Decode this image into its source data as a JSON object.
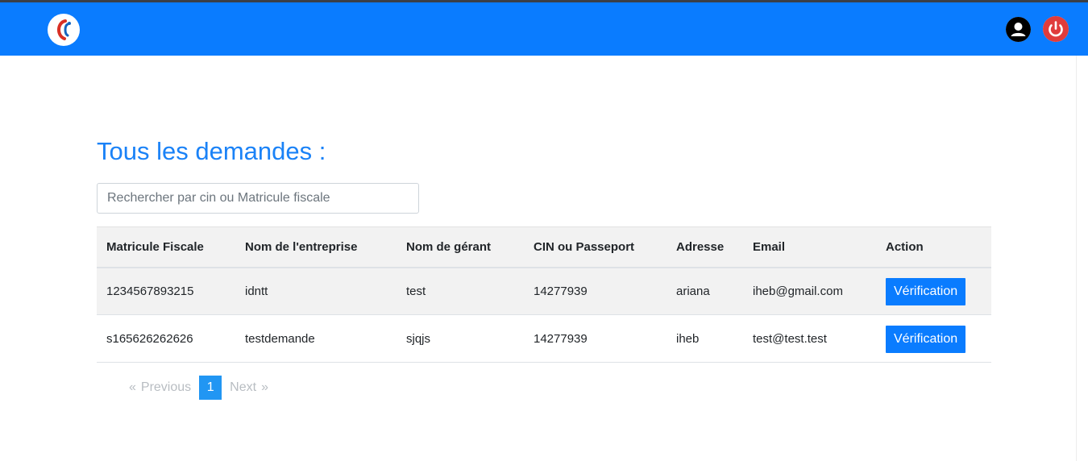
{
  "page": {
    "title": "Tous les demandes :"
  },
  "search": {
    "placeholder": "Rechercher par cin ou Matricule fiscale",
    "value": ""
  },
  "table": {
    "headers": [
      "Matricule Fiscale",
      "Nom de l'entreprise",
      "Nom de gérant",
      "CIN ou Passeport",
      "Adresse",
      "Email",
      "Action"
    ],
    "rows": [
      {
        "matricule": "1234567893215",
        "entreprise": "idntt",
        "gerant": "test",
        "cin": "14277939",
        "adresse": "ariana",
        "email": "iheb@gmail.com",
        "action": "Vérification"
      },
      {
        "matricule": "s165626262626",
        "entreprise": "testdemande",
        "gerant": "sjqjs",
        "cin": "14277939",
        "adresse": "iheb",
        "email": "test@test.test",
        "action": "Vérification"
      }
    ]
  },
  "pagination": {
    "first_symbol": "«",
    "previous": "Previous",
    "current": "1",
    "next": "Next",
    "last_symbol": "»"
  },
  "colors": {
    "navbar": "#0a7cff",
    "accent": "#1a82f7",
    "power_icon": "#e03c3c"
  },
  "icons": {
    "logo": "brand-logo-icon",
    "user": "user-icon",
    "power": "power-icon"
  }
}
